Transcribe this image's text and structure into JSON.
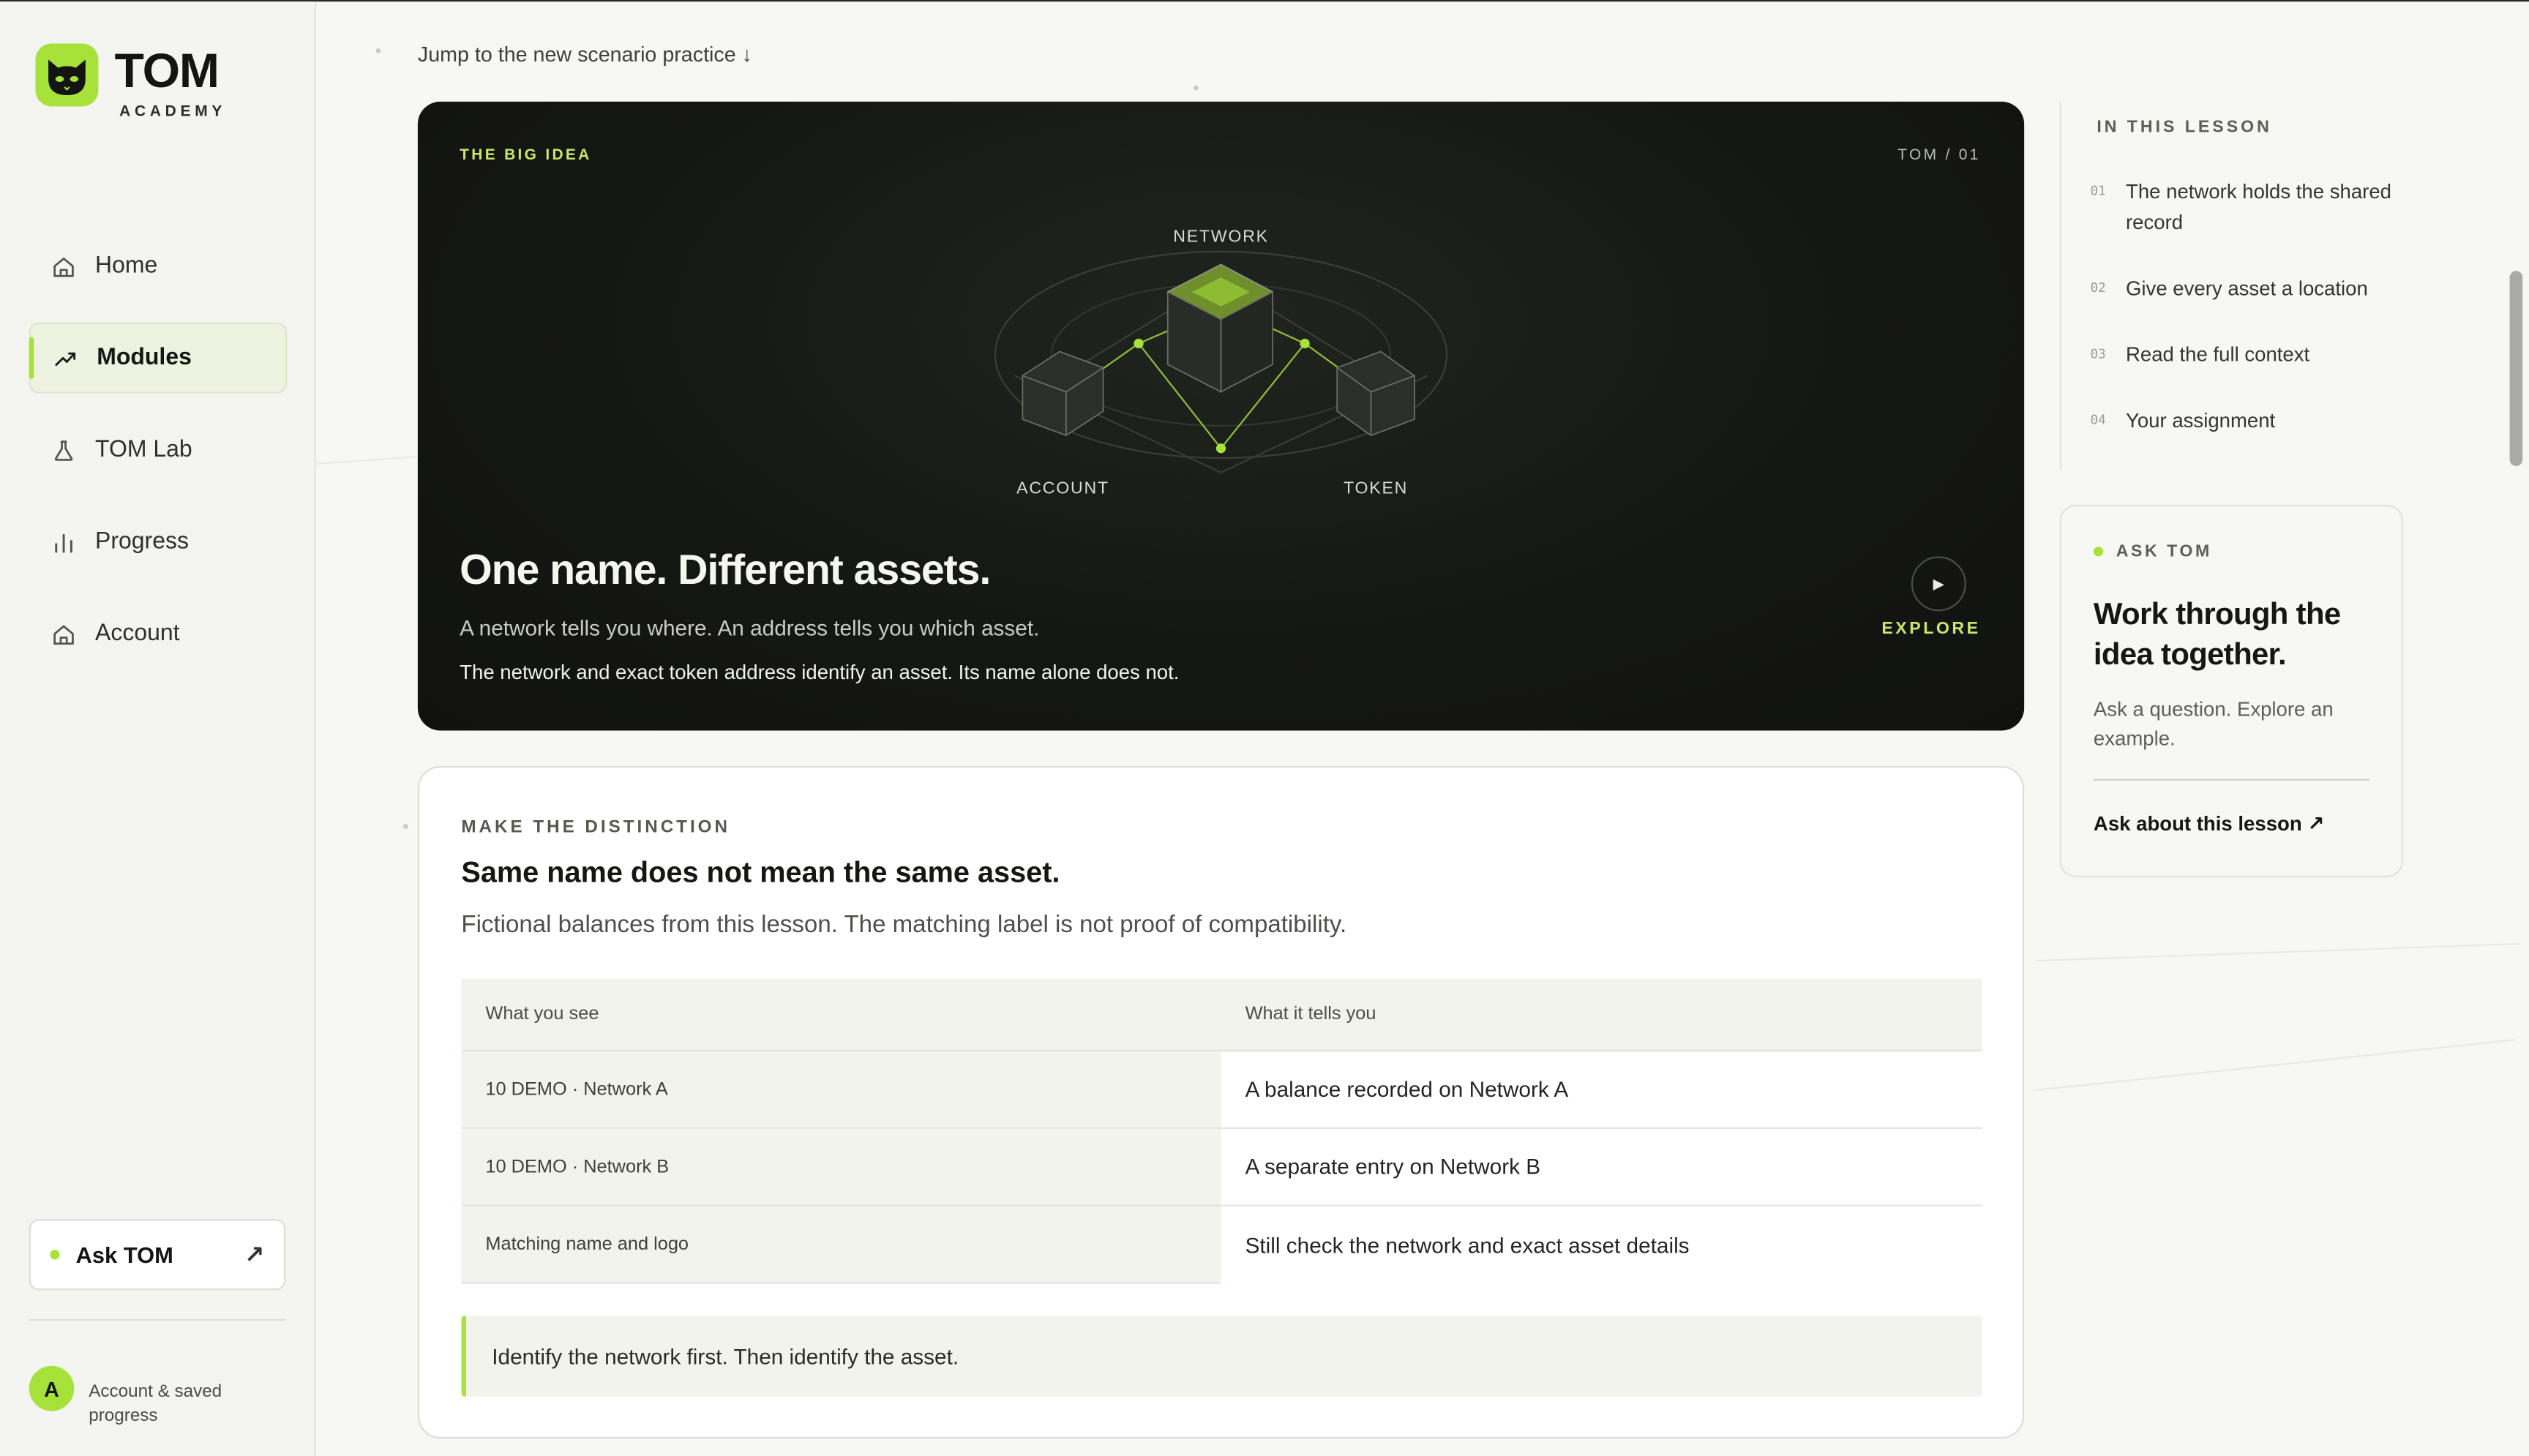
{
  "brand": {
    "name": "TOM",
    "sub": "ACADEMY"
  },
  "nav": [
    {
      "label": "Home",
      "icon": "home-icon"
    },
    {
      "label": "Modules",
      "icon": "trend-icon",
      "active": true
    },
    {
      "label": "TOM Lab",
      "icon": "flask-icon"
    },
    {
      "label": "Progress",
      "icon": "bar-chart-icon"
    },
    {
      "label": "Account",
      "icon": "home-icon"
    }
  ],
  "sidebar": {
    "ask_label": "Ask TOM",
    "avatar_letter": "A",
    "account_text": "Account & saved progress"
  },
  "jump_link": "Jump to the new scenario practice ↓",
  "hero": {
    "eyebrow": "THE BIG IDEA",
    "tag": "TOM / 01",
    "diagram_labels": {
      "network": "NETWORK",
      "account": "ACCOUNT",
      "token": "TOKEN"
    },
    "title": "One name. Different assets.",
    "subtitle": "A network tells you where. An address tells you which asset.",
    "note": "The network and exact token address identify an asset. Its name alone does not.",
    "explore_label": "EXPLORE"
  },
  "distinction": {
    "eyebrow": "MAKE THE DISTINCTION",
    "title": "Same name does not mean the same asset.",
    "subtitle": "Fictional balances from this lesson. The matching label is not proof of compatibility.",
    "columns": [
      "What you see",
      "What it tells you"
    ],
    "rows": [
      [
        "10 DEMO · Network A",
        "A balance recorded on Network A"
      ],
      [
        "10 DEMO · Network B",
        "A separate entry on Network B"
      ],
      [
        "Matching name and logo",
        "Still check the network and exact asset details"
      ]
    ],
    "callout": "Identify the network first. Then identify the asset."
  },
  "toc": {
    "title": "IN THIS LESSON",
    "items": [
      {
        "num": "01",
        "label": "The network holds the shared record"
      },
      {
        "num": "02",
        "label": "Give every asset a location"
      },
      {
        "num": "03",
        "label": "Read the full context"
      },
      {
        "num": "04",
        "label": "Your assignment"
      }
    ]
  },
  "ask_card": {
    "eyebrow": "ASK TOM",
    "title": "Work through the idea together.",
    "text": "Ask a question. Explore an example.",
    "link": "Ask about this lesson ↗"
  },
  "colors": {
    "accent": "#a7e23a",
    "hero_bg": "#151714",
    "background": "#f7f7f3"
  }
}
